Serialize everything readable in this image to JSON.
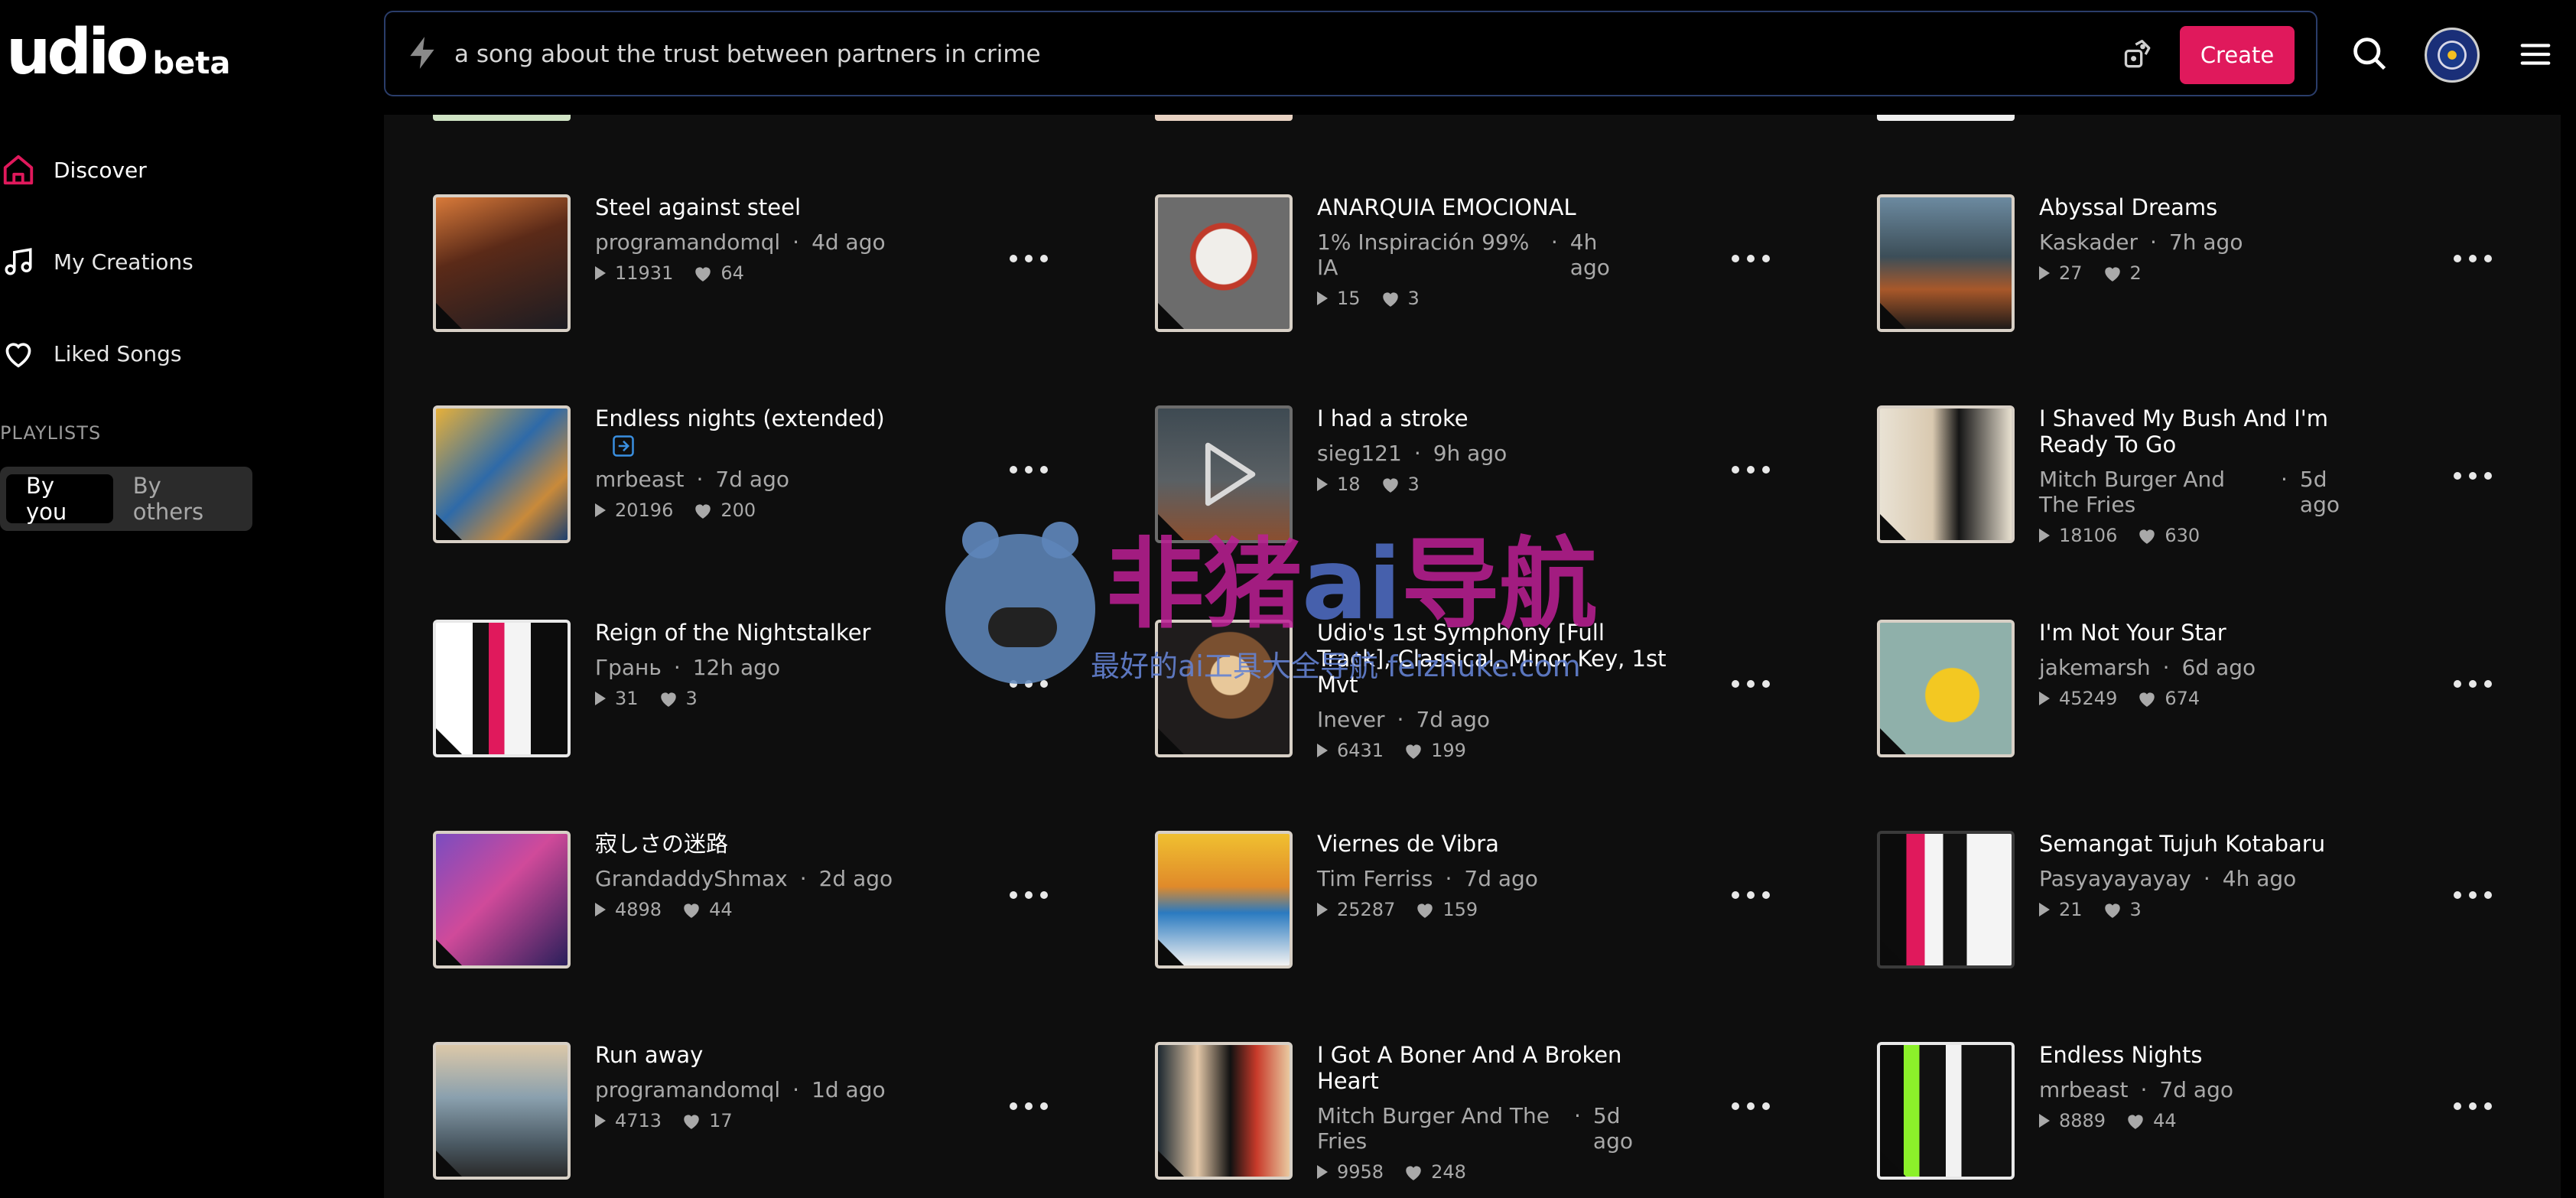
{
  "logo": {
    "brand": "udio",
    "badge": "beta"
  },
  "sidebar": {
    "items": [
      {
        "label": "Discover",
        "icon": "home-icon",
        "active": true
      },
      {
        "label": "My Creations",
        "icon": "music-note-icon",
        "active": false
      },
      {
        "label": "Liked Songs",
        "icon": "heart-icon",
        "active": false
      }
    ],
    "playlists_label": "PLAYLISTS",
    "toggle": {
      "by_you": "By you",
      "by_others": "By others",
      "selected": "By you"
    }
  },
  "topbar": {
    "prompt_value": "a song about the trust between partners in crime",
    "create_label": "Create"
  },
  "colors": {
    "accent": "#e0195c",
    "background": "#0e0e0e",
    "sidebar": "#000000"
  },
  "songs": [
    {
      "title": "Steel against steel",
      "artist": "programandomql",
      "age": "4d ago",
      "plays": "11931",
      "likes": "64"
    },
    {
      "title": "ANARQUIA EMOCIONAL",
      "artist": "1% Inspiración 99% IA",
      "age": "4h ago",
      "plays": "15",
      "likes": "3"
    },
    {
      "title": "Abyssal Dreams",
      "artist": "Kaskader",
      "age": "7h ago",
      "plays": "27",
      "likes": "2"
    },
    {
      "title": "Endless nights (extended)",
      "artist": "mrbeast",
      "age": "7d ago",
      "plays": "20196",
      "likes": "200",
      "extended": true
    },
    {
      "title": "I had a stroke",
      "artist": "sieg121",
      "age": "9h ago",
      "plays": "18",
      "likes": "3"
    },
    {
      "title": "I Shaved My Bush And I'm Ready To Go",
      "artist": "Mitch Burger And The Fries",
      "age": "5d ago",
      "plays": "18106",
      "likes": "630"
    },
    {
      "title": "Reign of the Nightstalker",
      "artist": "Грань",
      "age": "12h ago",
      "plays": "31",
      "likes": "3"
    },
    {
      "title": "Udio's 1st Symphony [Full Track], Classical, Minor Key, 1st Mvt",
      "artist": "Inever",
      "age": "7d ago",
      "plays": "6431",
      "likes": "199"
    },
    {
      "title": "I'm Not Your Star",
      "artist": "jakemarsh",
      "age": "6d ago",
      "plays": "45249",
      "likes": "674"
    },
    {
      "title": "寂しさの迷路",
      "artist": "GrandaddyShmax",
      "age": "2d ago",
      "plays": "4898",
      "likes": "44"
    },
    {
      "title": "Viernes de Vibra",
      "artist": "Tim Ferriss",
      "age": "7d ago",
      "plays": "25287",
      "likes": "159"
    },
    {
      "title": "Semangat Tujuh Kotabaru",
      "artist": "Pasyayayayay",
      "age": "4h ago",
      "plays": "21",
      "likes": "3"
    },
    {
      "title": "Run away",
      "artist": "programandomql",
      "age": "1d ago",
      "plays": "4713",
      "likes": "17"
    },
    {
      "title": "I Got A Boner And A Broken Heart",
      "artist": "Mitch Burger And The Fries",
      "age": "5d ago",
      "plays": "9958",
      "likes": "248"
    },
    {
      "title": "Endless Nights",
      "artist": "mrbeast",
      "age": "7d ago",
      "plays": "8889",
      "likes": "44"
    }
  ],
  "watermark": {
    "big": "非猪",
    "ai": "ai",
    "rest": "导航",
    "small": "最好的ai工具大全导航 feizhuke.com"
  }
}
